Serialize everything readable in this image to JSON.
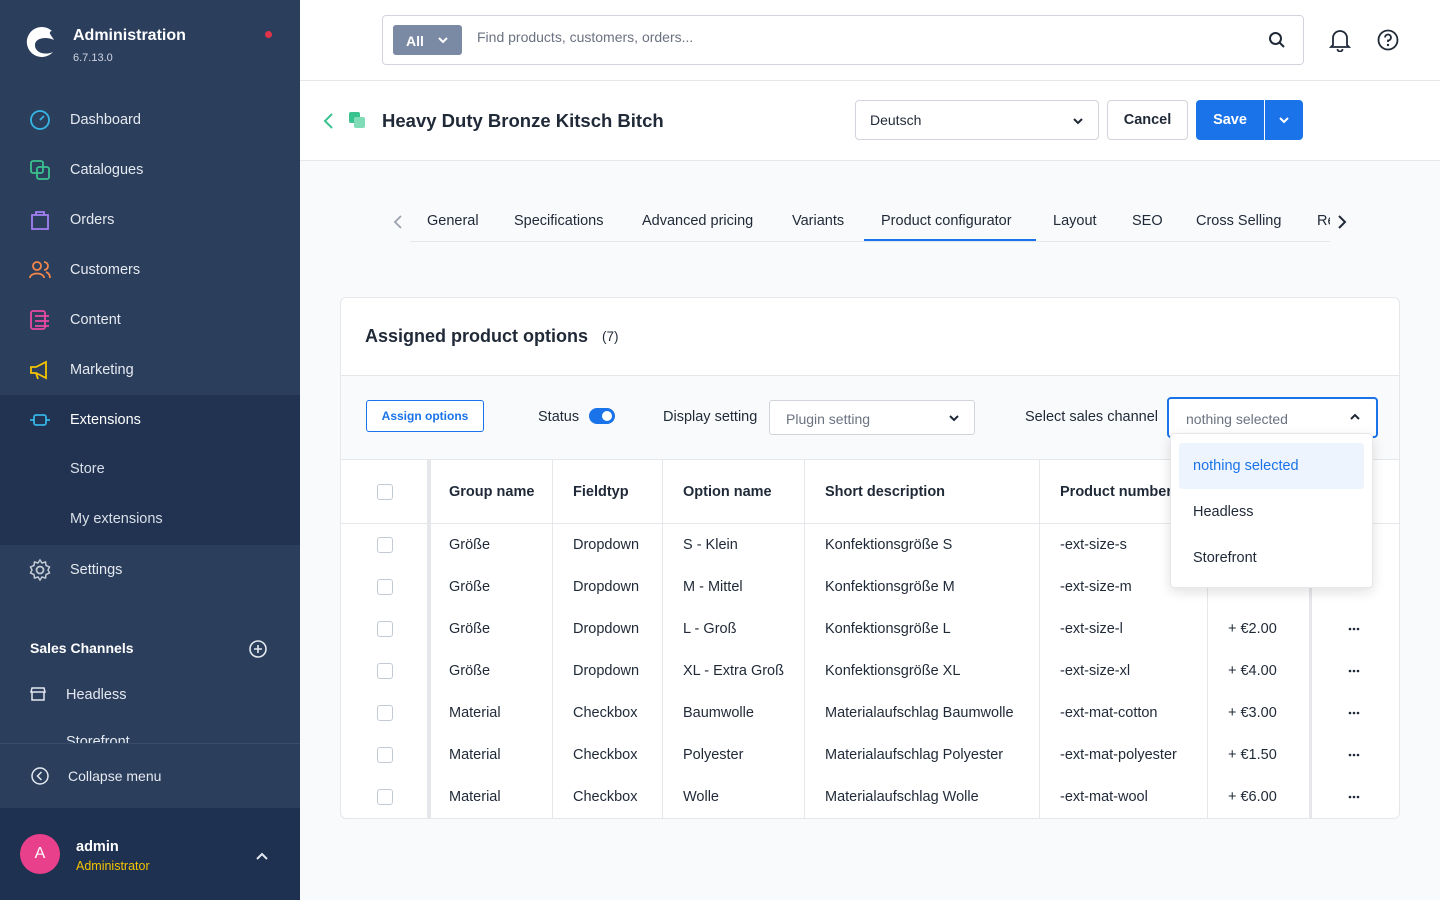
{
  "brand": {
    "title": "Administration",
    "version": "6.7.13.0"
  },
  "nav": {
    "items": [
      {
        "label": "Dashboard",
        "icon": "dashboard-icon"
      },
      {
        "label": "Catalogues",
        "icon": "catalogue-icon"
      },
      {
        "label": "Orders",
        "icon": "orders-icon"
      },
      {
        "label": "Customers",
        "icon": "customers-icon"
      },
      {
        "label": "Content",
        "icon": "content-icon"
      },
      {
        "label": "Marketing",
        "icon": "marketing-icon"
      },
      {
        "label": "Extensions",
        "icon": "extensions-icon"
      },
      {
        "label": "Settings",
        "icon": "settings-icon"
      }
    ],
    "extensions_sub": [
      "Store",
      "My extensions"
    ],
    "sales_channels_title": "Sales Channels",
    "sales_channels": [
      "Headless",
      "Storefront"
    ],
    "collapse_label": "Collapse menu"
  },
  "user": {
    "initial": "A",
    "name": "admin",
    "role": "Administrator"
  },
  "search": {
    "type_label": "All",
    "placeholder": "Find products, customers, orders..."
  },
  "smartbar": {
    "title": "Heavy Duty Bronze Kitsch Bitch",
    "language": "Deutsch",
    "cancel_label": "Cancel",
    "save_label": "Save"
  },
  "tabs": [
    "General",
    "Specifications",
    "Advanced pricing",
    "Variants",
    "Product configurator",
    "Layout",
    "SEO",
    "Cross Selling",
    "Re"
  ],
  "active_tab": "Product configurator",
  "card": {
    "title": "Assigned product options",
    "count": "(7)",
    "assign_label": "Assign options",
    "status_label": "Status",
    "status_on": true,
    "display_label": "Display setting",
    "display_value": "Plugin setting",
    "channel_label": "Select sales channel",
    "channel_value": "nothing selected"
  },
  "table": {
    "columns": [
      "Group name",
      "Fieldtyp",
      "Option name",
      "Short description",
      "Product number"
    ],
    "rows": [
      {
        "group": "Größe",
        "type": "Dropdown",
        "option": "S - Klein",
        "desc": "Konfektionsgröße S",
        "number": "-ext-size-s",
        "price": ""
      },
      {
        "group": "Größe",
        "type": "Dropdown",
        "option": "M - Mittel",
        "desc": "Konfektionsgröße M",
        "number": "-ext-size-m",
        "price": ""
      },
      {
        "group": "Größe",
        "type": "Dropdown",
        "option": "L - Groß",
        "desc": "Konfektionsgröße L",
        "number": "-ext-size-l",
        "price": "+ €2.00"
      },
      {
        "group": "Größe",
        "type": "Dropdown",
        "option": "XL - Extra Groß",
        "desc": "Konfektionsgröße XL",
        "number": "-ext-size-xl",
        "price": "+ €4.00"
      },
      {
        "group": "Material",
        "type": "Checkbox",
        "option": "Baumwolle",
        "desc": "Materialaufschlag Baumwolle",
        "number": "-ext-mat-cotton",
        "price": "+ €3.00"
      },
      {
        "group": "Material",
        "type": "Checkbox",
        "option": "Polyester",
        "desc": "Materialaufschlag Polyester",
        "number": "-ext-mat-polyester",
        "price": "+ €1.50"
      },
      {
        "group": "Material",
        "type": "Checkbox",
        "option": "Wolle",
        "desc": "Materialaufschlag Wolle",
        "number": "-ext-mat-wool",
        "price": "+ €6.00"
      }
    ]
  },
  "dropdown": {
    "options": [
      "nothing selected",
      "Headless",
      "Storefront"
    ],
    "selected": "nothing selected"
  },
  "colors": {
    "sidebar": "#2b3e5c",
    "accent": "#1a73e8",
    "avatar": "#e8408b",
    "role": "#f5c400"
  }
}
